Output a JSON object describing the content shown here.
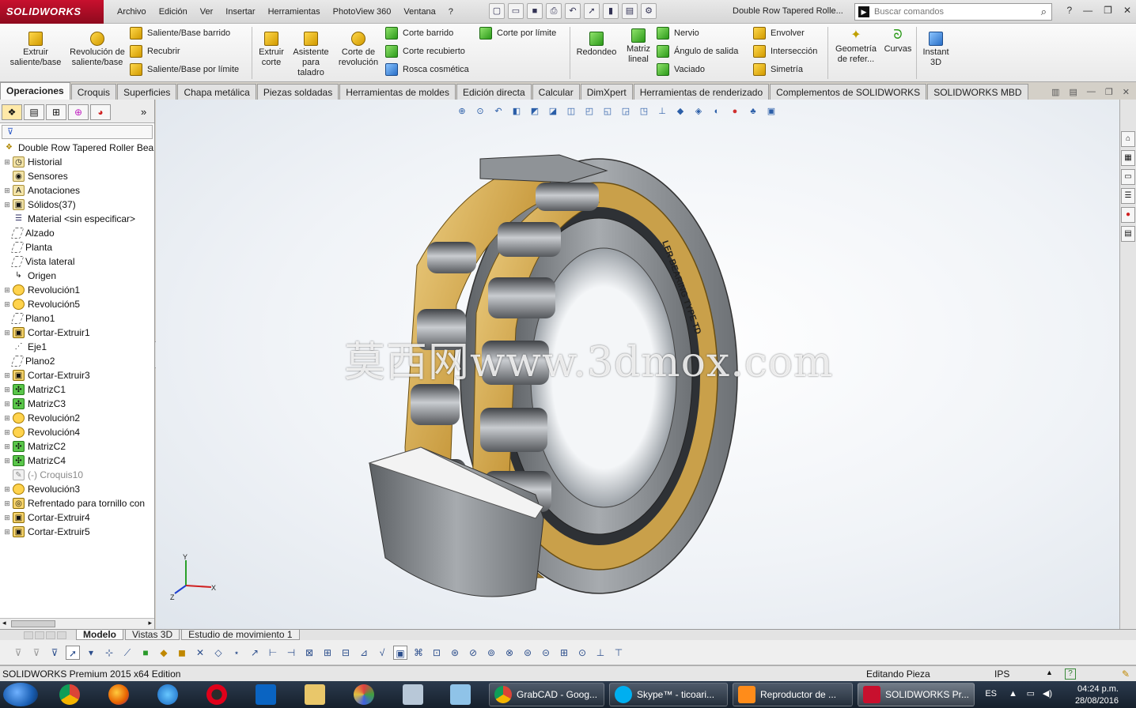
{
  "app": {
    "logo_text": "SOLIDWORKS",
    "menu": [
      "Archivo",
      "Edición",
      "Ver",
      "Insertar",
      "Herramientas",
      "PhotoView 360",
      "Ventana",
      "?"
    ],
    "document_title": "Double Row Tapered Rolle...",
    "search_placeholder": "Buscar comandos",
    "help_label": "?"
  },
  "ribbon": {
    "extrude_boss": "Extruir saliente/base",
    "revolve_boss": "Revolución de saliente/base",
    "swept_boss": "Saliente/Base barrido",
    "recubrir": "Recubrir",
    "boundary_boss": "Saliente/Base por límite",
    "extrude_cut": "Extruir corte",
    "hole_wizard": "Asistente para taladro",
    "revolve_cut": "Corte de revolución",
    "swept_cut": "Corte barrido",
    "lofted_cut": "Corte recubierto",
    "cosmetic_thread": "Rosca cosmética",
    "boundary_cut": "Corte por límite",
    "fillet": "Redondeo",
    "linear_pattern": "Matriz lineal",
    "rib": "Nervio",
    "draft": "Ángulo de salida",
    "shell": "Vaciado",
    "wrap": "Envolver",
    "intersect": "Intersección",
    "mirror": "Simetría",
    "ref_geometry": "Geometría de refer...",
    "curves": "Curvas",
    "instant3d": "Instant 3D"
  },
  "tabs": [
    "Operaciones",
    "Croquis",
    "Superficies",
    "Chapa metálica",
    "Piezas soldadas",
    "Herramientas de moldes",
    "Edición directa",
    "Calcular",
    "DimXpert",
    "Herramientas de renderizado",
    "Complementos de SOLIDWORKS",
    "SOLIDWORKS MBD"
  ],
  "tree": {
    "root": "Double Row Tapered Roller Bearing",
    "items": [
      {
        "label": "Historial",
        "icon": "history-icon",
        "exp": "+"
      },
      {
        "label": "Sensores",
        "icon": "sensor-icon",
        "exp": ""
      },
      {
        "label": "Anotaciones",
        "icon": "annotation-icon",
        "exp": "+"
      },
      {
        "label": "Sólidos(37)",
        "icon": "solid-bodies-icon",
        "exp": "+"
      },
      {
        "label": "Material <sin especificar>",
        "icon": "material-icon",
        "exp": ""
      },
      {
        "label": "Alzado",
        "icon": "plane-icon",
        "exp": ""
      },
      {
        "label": "Planta",
        "icon": "plane-icon",
        "exp": ""
      },
      {
        "label": "Vista lateral",
        "icon": "plane-icon",
        "exp": ""
      },
      {
        "label": "Origen",
        "icon": "origin-icon",
        "exp": ""
      },
      {
        "label": "Revolución1",
        "icon": "revolve-icon",
        "exp": "+"
      },
      {
        "label": "Revolución5",
        "icon": "revolve-icon",
        "exp": "+"
      },
      {
        "label": "Plano1",
        "icon": "plane-icon",
        "exp": ""
      },
      {
        "label": "Cortar-Extruir1",
        "icon": "cut-extrude-icon",
        "exp": "+"
      },
      {
        "label": "Eje1",
        "icon": "axis-icon",
        "exp": ""
      },
      {
        "label": "Plano2",
        "icon": "plane-icon",
        "exp": ""
      },
      {
        "label": "Cortar-Extruir3",
        "icon": "cut-extrude-icon",
        "exp": "+"
      },
      {
        "label": "MatrizC1",
        "icon": "pattern-icon",
        "exp": "+"
      },
      {
        "label": "MatrizC3",
        "icon": "pattern-icon",
        "exp": "+"
      },
      {
        "label": "Revolución2",
        "icon": "revolve-icon",
        "exp": "+"
      },
      {
        "label": "Revolución4",
        "icon": "revolve-icon",
        "exp": "+"
      },
      {
        "label": "MatrizC2",
        "icon": "pattern-icon",
        "exp": "+"
      },
      {
        "label": "MatrizC4",
        "icon": "pattern-icon",
        "exp": "+"
      },
      {
        "label": "(-) Croquis10",
        "icon": "sketch-icon",
        "exp": "",
        "dim": true
      },
      {
        "label": "Revolución3",
        "icon": "revolve-icon",
        "exp": "+"
      },
      {
        "label": "Refrentado para tornillo con",
        "icon": "hole-icon",
        "exp": "+"
      },
      {
        "label": "Cortar-Extruir4",
        "icon": "cut-extrude-icon",
        "exp": "+"
      },
      {
        "label": "Cortar-Extruir5",
        "icon": "cut-extrude-icon",
        "exp": "+"
      }
    ]
  },
  "viewport": {
    "watermark": "莫西网www.3dmox.com",
    "triad_x": "X",
    "triad_y": "Y",
    "triad_z": "Z"
  },
  "bottom_tabs": [
    "Modelo",
    "Vistas 3D",
    "Estudio de movimiento 1"
  ],
  "status": {
    "edition": "SOLIDWORKS Premium 2015 x64 Edition",
    "mode": "Editando Pieza",
    "units": "IPS"
  },
  "taskbar": {
    "windows": [
      "GrabCAD - Goog...",
      "Skype™ - ticoari...",
      "Reproductor de ...",
      "SOLIDWORKS Pr..."
    ],
    "lang": "ES",
    "time": "04:24 p.m.",
    "date": "28/08/2016"
  },
  "colors": {
    "brand_red": "#c8102e",
    "cage_gold": "#d9b25e",
    "steel": "#8a8d91"
  }
}
